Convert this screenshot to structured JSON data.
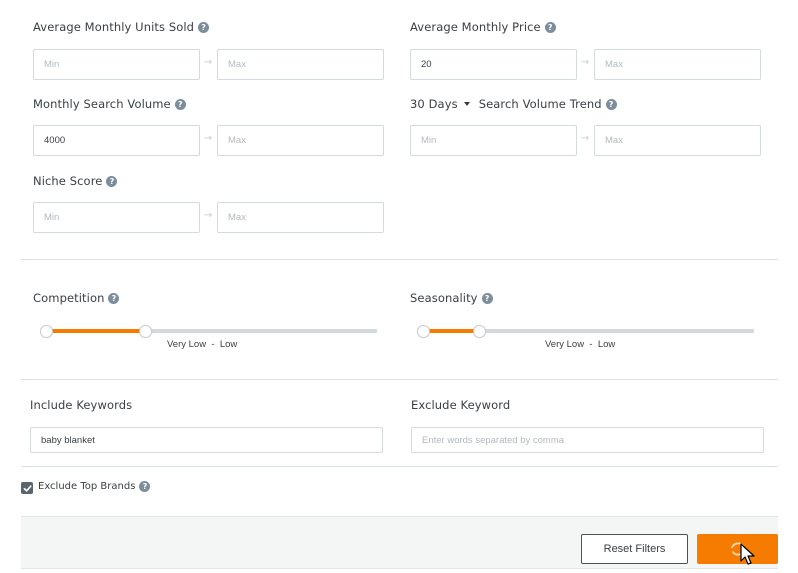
{
  "filters": {
    "avg_units_sold": {
      "label": "Average Monthly Units Sold",
      "min_value": "",
      "min_placeholder": "Min",
      "max_value": "",
      "max_placeholder": "Max"
    },
    "avg_price": {
      "label": "Average Monthly Price",
      "min_value": "20",
      "min_placeholder": "Min",
      "max_value": "",
      "max_placeholder": "Max"
    },
    "search_volume": {
      "label": "Monthly Search Volume",
      "min_value": "4000",
      "min_placeholder": "Min",
      "max_value": "",
      "max_placeholder": "Max"
    },
    "search_trend": {
      "period": "30 Days",
      "label": "Search Volume Trend",
      "min_value": "",
      "min_placeholder": "Min",
      "max_value": "",
      "max_placeholder": "Max"
    },
    "niche_score": {
      "label": "Niche Score",
      "min_value": "",
      "min_placeholder": "Min",
      "max_value": "",
      "max_placeholder": "Max"
    }
  },
  "sliders": {
    "competition": {
      "label": "Competition",
      "range_start": 0.0,
      "range_end": 0.3,
      "caption_low": "Very Low",
      "separator": "-",
      "caption_high": "Low"
    },
    "seasonality": {
      "label": "Seasonality",
      "range_start": 0.0,
      "range_end": 0.17,
      "caption_low": "Very Low",
      "separator": "-",
      "caption_high": "Low"
    }
  },
  "keywords": {
    "include": {
      "label": "Include Keywords",
      "value": "baby blanket",
      "placeholder": ""
    },
    "exclude": {
      "label": "Exclude Keyword",
      "value": "",
      "placeholder": "Enter words separated by comma"
    }
  },
  "exclude_top_brands": {
    "label": "Exclude Top Brands",
    "checked": true
  },
  "actions": {
    "reset_label": "Reset Filters",
    "search_icon": "refresh-spinner-icon"
  },
  "icons": {
    "help": "?",
    "arrow": "→",
    "check": "✓"
  },
  "colors": {
    "accent": "#f57c00",
    "track": "#d3d9dd",
    "help_icon": "#7c8d9b"
  }
}
